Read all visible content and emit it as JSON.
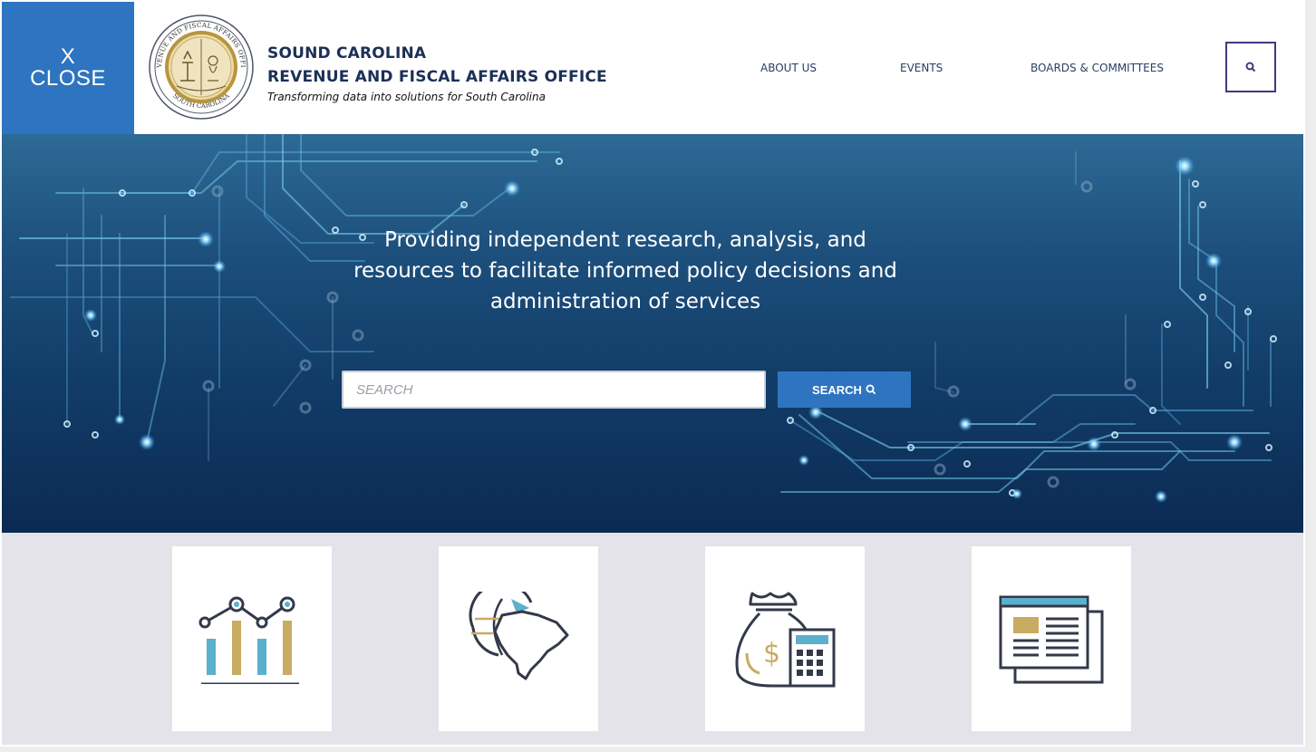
{
  "header": {
    "close_x": "X",
    "close_label": "CLOSE",
    "brand_line1": "SOUND CAROLINA",
    "brand_line2": "REVENUE AND FISCAL AFFAIRS OFFICE",
    "tagline": "Transforming data into solutions for South Carolina",
    "seal_text_top": "REVENUE AND FISCAL AFFAIRS OFFICE",
    "seal_text_bottom": "SOUTH CAROLINA",
    "nav": [
      {
        "label": "ABOUT US"
      },
      {
        "label": "EVENTS"
      },
      {
        "label": "BOARDS & COMMITTEES"
      }
    ],
    "search_toggle_icon": "search-icon"
  },
  "hero": {
    "headline": "Providing independent research, analysis, and resources to facilitate informed policy decisions and administration of services",
    "search_placeholder": "SEARCH",
    "search_value": "",
    "search_button": "SEARCH"
  },
  "tiles": [
    {
      "icon": "bar-line-chart-icon"
    },
    {
      "icon": "south-carolina-globe-icon"
    },
    {
      "icon": "money-bag-calculator-icon"
    },
    {
      "icon": "newspaper-document-icon"
    }
  ],
  "colors": {
    "accent_blue": "#2f74c0",
    "navy_text": "#1c2f57",
    "gold": "#c9ab62",
    "teal": "#5bb0cc",
    "icon_stroke": "#33394a"
  }
}
